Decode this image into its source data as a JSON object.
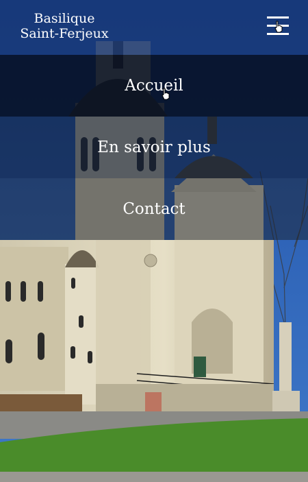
{
  "site": {
    "title_line1": "Basilique",
    "title_line2": "Saint-Ferjeux"
  },
  "menu": {
    "icon": "hamburger-icon"
  },
  "nav": {
    "items": [
      {
        "label": "Accueil",
        "active": true
      },
      {
        "label": "En savoir plus",
        "active": false
      },
      {
        "label": "Contact",
        "active": false
      }
    ]
  },
  "colors": {
    "header_bg": "#163470",
    "active_item_bg": "#060e20",
    "text": "#ffffff"
  }
}
